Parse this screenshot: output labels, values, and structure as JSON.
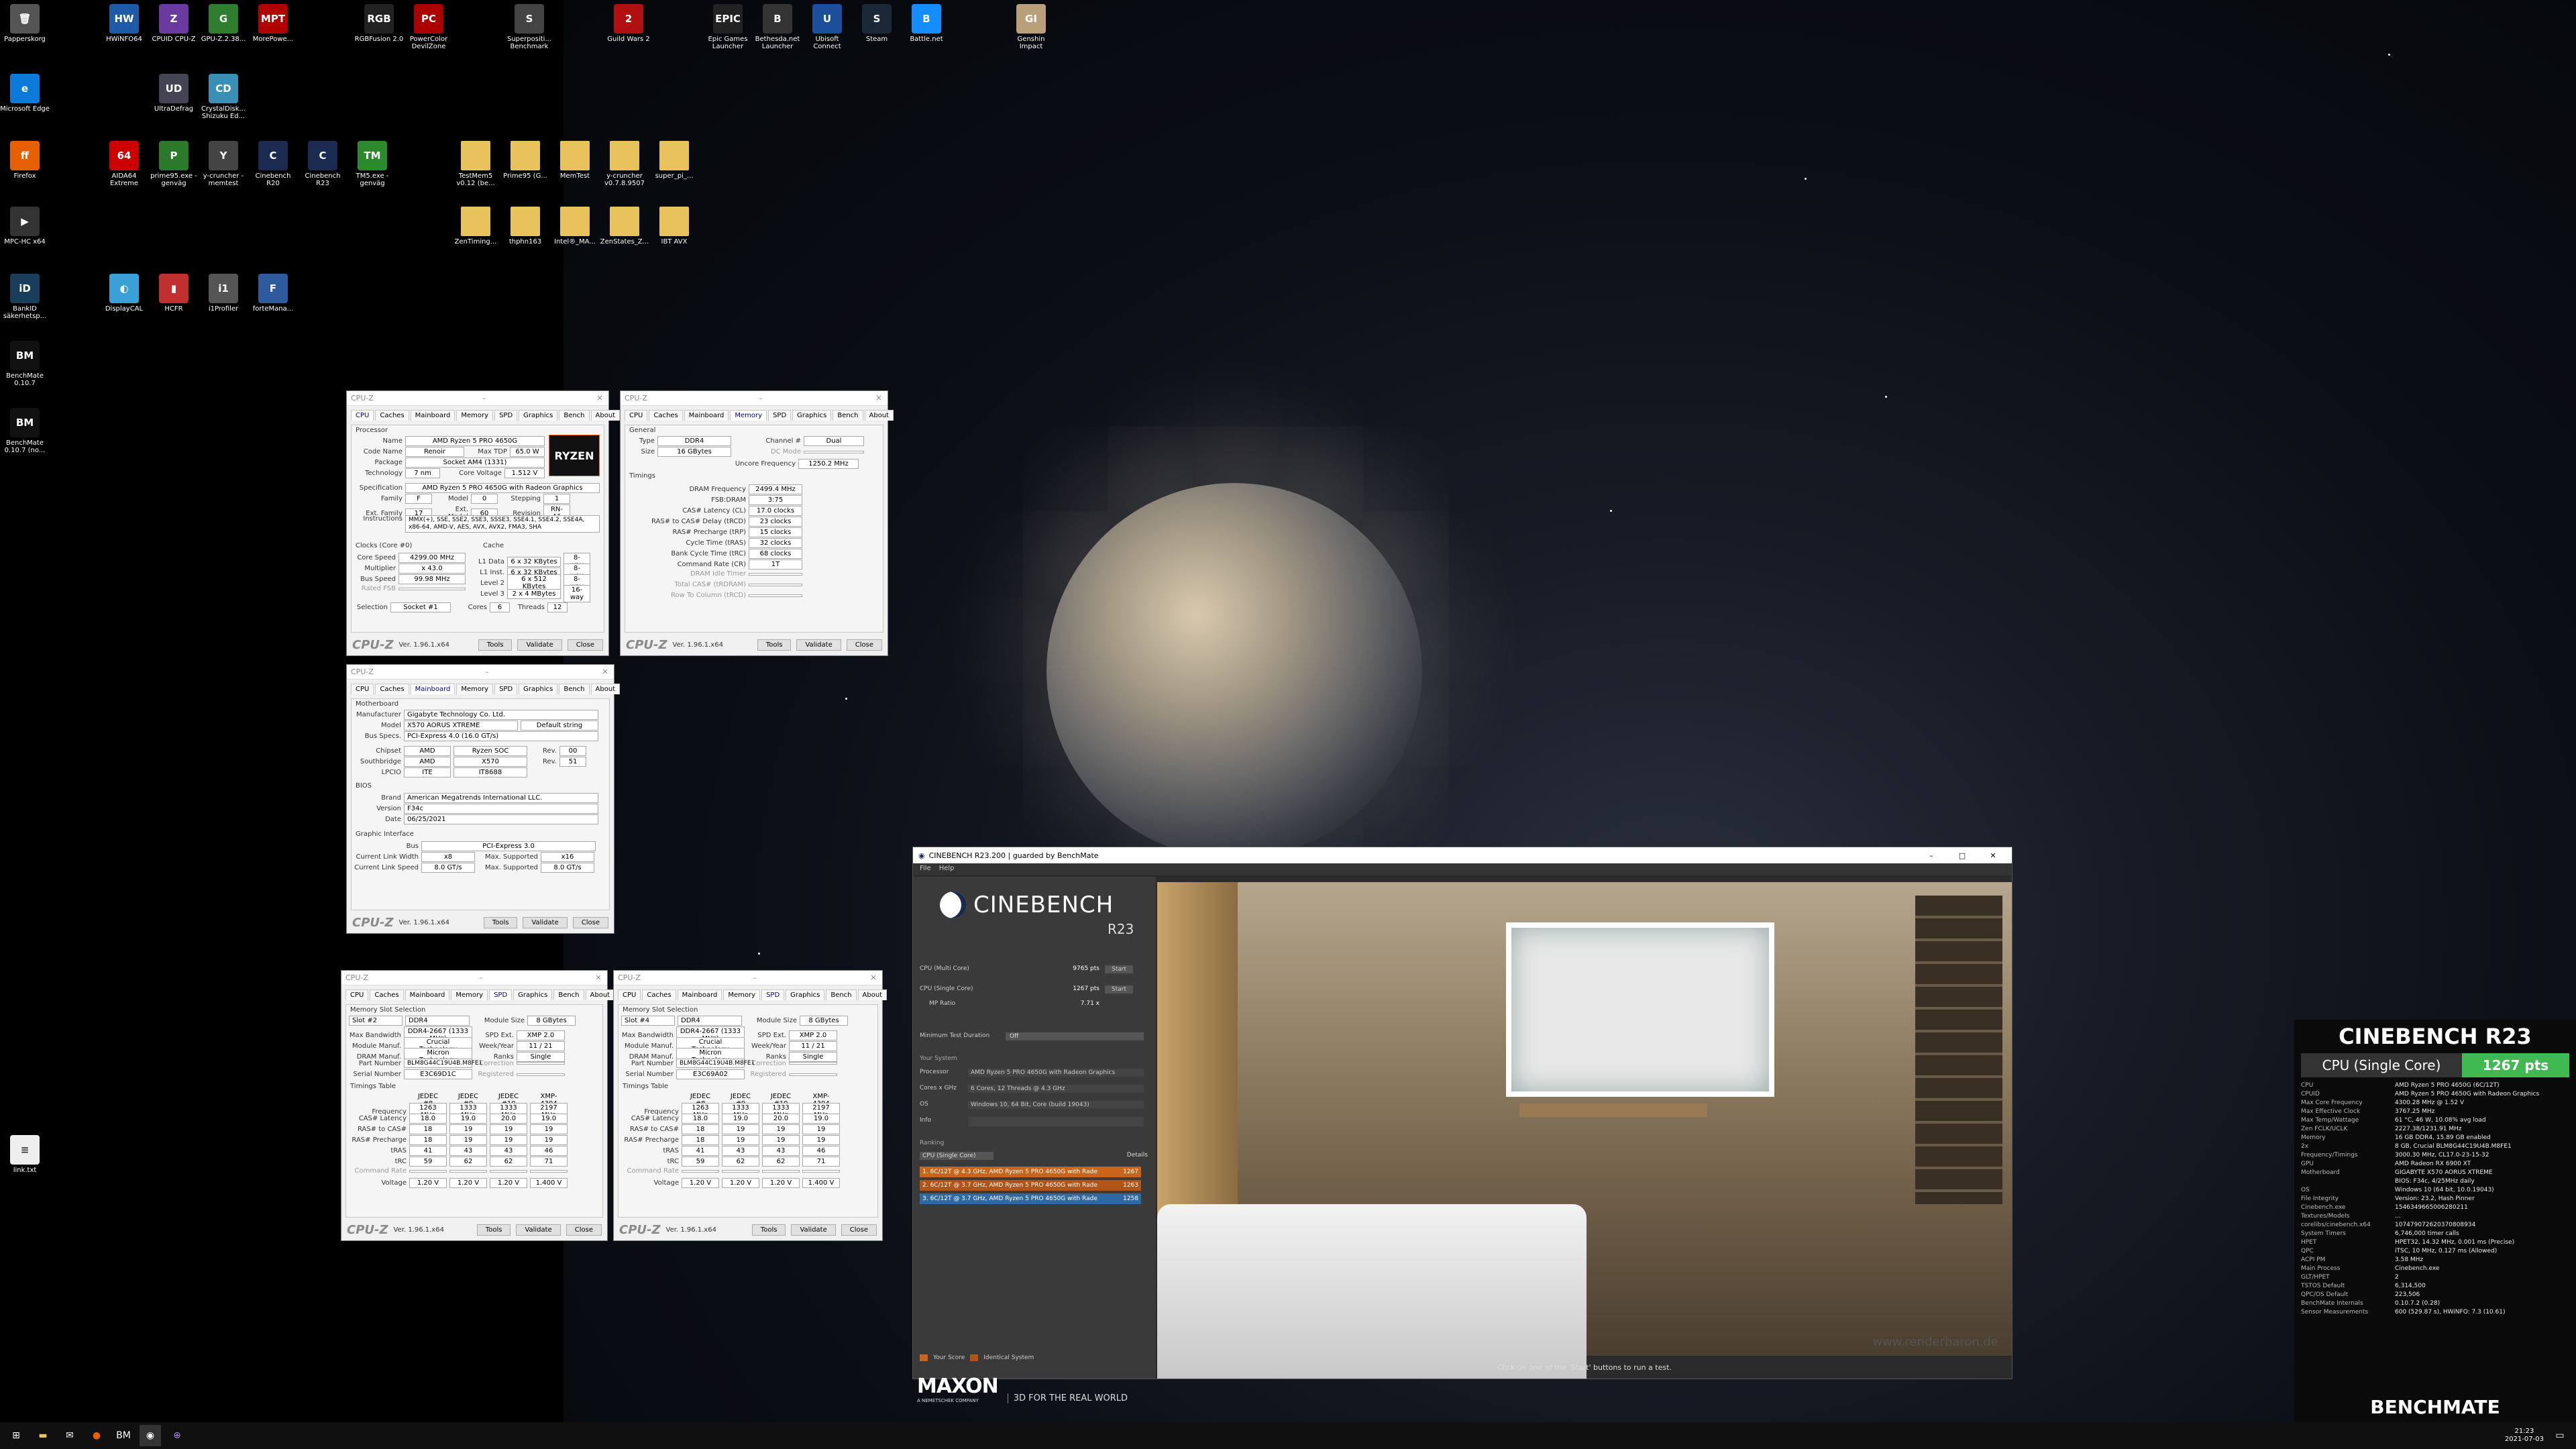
{
  "desktop": {
    "icons": [
      {
        "name": "Papperskorg",
        "glyph": "🗑",
        "color": "#555"
      },
      {
        "name": "HWiNFO64",
        "glyph": "HW",
        "color": "#1d5aa8"
      },
      {
        "name": "CPUID CPU-Z",
        "glyph": "Z",
        "color": "#6b3aa0"
      },
      {
        "name": "GPU-Z.2.38...",
        "glyph": "G",
        "color": "#2f7d2f"
      },
      {
        "name": "MorePowe...",
        "glyph": "MPT",
        "color": "#b00000"
      },
      {
        "name": "RGBFusion 2.0",
        "glyph": "RGB",
        "color": "#222"
      },
      {
        "name": "PowerColor DevilZone",
        "glyph": "PC",
        "color": "#a00"
      },
      {
        "name": "Superpositi... Benchmark",
        "glyph": "S",
        "color": "#444"
      },
      {
        "name": "Guild Wars 2",
        "glyph": "2",
        "color": "#b01010"
      },
      {
        "name": "Epic Games Launcher",
        "glyph": "EPIC",
        "color": "#222"
      },
      {
        "name": "Bethesda.net Launcher",
        "glyph": "B",
        "color": "#333"
      },
      {
        "name": "Ubisoft Connect",
        "glyph": "U",
        "color": "#1b4f9c"
      },
      {
        "name": "Steam",
        "glyph": "S",
        "color": "#1b2838"
      },
      {
        "name": "Battle.net",
        "glyph": "B",
        "color": "#148eff"
      },
      {
        "name": "Genshin Impact",
        "glyph": "GI",
        "color": "#b9a07a"
      },
      {
        "name": "Microsoft Edge",
        "glyph": "e",
        "color": "#0c7ad8"
      },
      {
        "name": "UltraDefrag",
        "glyph": "UD",
        "color": "#445"
      },
      {
        "name": "CrystalDisk... Shizuku Ed...",
        "glyph": "CD",
        "color": "#3a8fb7"
      },
      {
        "name": "Firefox",
        "glyph": "ff",
        "color": "#e66000"
      },
      {
        "name": "AIDA64 Extreme",
        "glyph": "64",
        "color": "#c00"
      },
      {
        "name": "prime95.exe - genväg",
        "glyph": "P",
        "color": "#2a7a2a"
      },
      {
        "name": "y-cruncher - memtest",
        "glyph": "Y",
        "color": "#444"
      },
      {
        "name": "Cinebench R20",
        "glyph": "C",
        "color": "#1b2a50"
      },
      {
        "name": "Cinebench R23",
        "glyph": "C",
        "color": "#1b2a50"
      },
      {
        "name": "TM5.exe - genväg",
        "glyph": "TM",
        "color": "#2b8a2b"
      },
      {
        "name": "TestMem5 v0.12 (be...",
        "glyph": "",
        "color": "#e8c25a"
      },
      {
        "name": "Prime95 (G...",
        "glyph": "",
        "color": "#e8c25a"
      },
      {
        "name": "MemTest",
        "glyph": "",
        "color": "#e8c25a"
      },
      {
        "name": "y-cruncher v0.7.8.9507",
        "glyph": "",
        "color": "#e8c25a"
      },
      {
        "name": "super_pi_...",
        "glyph": "",
        "color": "#e8c25a"
      },
      {
        "name": "MPC-HC x64",
        "glyph": "▶",
        "color": "#333"
      },
      {
        "name": "ZenTiming...",
        "glyph": "",
        "color": "#e8c25a"
      },
      {
        "name": "thphn163",
        "glyph": "",
        "color": "#e8c25a"
      },
      {
        "name": "Intel®_MA...",
        "glyph": "",
        "color": "#e8c25a"
      },
      {
        "name": "ZenStates_Z...",
        "glyph": "",
        "color": "#e8c25a"
      },
      {
        "name": "IBT AVX",
        "glyph": "",
        "color": "#e8c25a"
      },
      {
        "name": "BankID säkerhetsp...",
        "glyph": "iD",
        "color": "#193e5c"
      },
      {
        "name": "DisplayCAL",
        "glyph": "◐",
        "color": "#3aa0d8"
      },
      {
        "name": "HCFR",
        "glyph": "▮",
        "color": "#c03030"
      },
      {
        "name": "i1Profiler",
        "glyph": "i1",
        "color": "#555"
      },
      {
        "name": "forteMana...",
        "glyph": "F",
        "color": "#2e5a9e"
      },
      {
        "name": "BenchMate 0.10.7",
        "glyph": "BM",
        "color": "#111"
      },
      {
        "name": "BenchMate 0.10.7 (no...",
        "glyph": "BM",
        "color": "#111"
      },
      {
        "name": "link.txt",
        "glyph": "≡",
        "color": "#eee"
      }
    ]
  },
  "cpuz1": {
    "title": "CPU-Z",
    "tabs": [
      "CPU",
      "Caches",
      "Mainboard",
      "Memory",
      "SPD",
      "Graphics",
      "Bench",
      "About"
    ],
    "processor_label": "Processor",
    "name": "AMD Ryzen 5 PRO 4650G",
    "code_name": "Renoir",
    "max_tdp": "65.0 W",
    "package": "Socket AM4 (1331)",
    "technology": "7 nm",
    "core_voltage": "1.512 V",
    "spec": "AMD Ryzen 5 PRO 4650G with Radeon Graphics",
    "family": "F",
    "model": "0",
    "stepping": "1",
    "ext_family": "17",
    "ext_model": "60",
    "revision": "RN-A1",
    "instructions": "MMX(+), SSE, SSE2, SSE3, SSSE3, SSE4.1, SSE4.2, SSE4A, x86-64, AMD-V, AES, AVX, AVX2, FMA3, SHA",
    "clocks_label": "Clocks (Core #0)",
    "core_speed": "4299.00 MHz",
    "multiplier": "x 43.0",
    "bus_speed": "99.98 MHz",
    "rated_fsb": "",
    "cache_label": "Cache",
    "l1d": "6 x 32 KBytes",
    "l1d_w": "8-way",
    "l1i": "6 x 32 KBytes",
    "l1i_w": "8-way",
    "l2": "6 x 512 KBytes",
    "l2_w": "8-way",
    "l3": "2 x 4 MBytes",
    "l3_w": "16-way",
    "selection": "Socket #1",
    "cores": "6",
    "threads": "12",
    "k": {
      "name": "Name",
      "code": "Code Name",
      "tdp": "Max TDP",
      "pkg": "Package",
      "tech": "Technology",
      "cv": "Core Voltage",
      "spec": "Specification",
      "fam": "Family",
      "model": "Model",
      "step": "Stepping",
      "efam": "Ext. Family",
      "emod": "Ext. Model",
      "rev": "Revision",
      "inst": "Instructions",
      "cs": "Core Speed",
      "mul": "Multiplier",
      "bus": "Bus Speed",
      "fsb": "Rated FSB",
      "l1d": "L1 Data",
      "l1i": "L1 Inst.",
      "l2": "Level 2",
      "l3": "Level 3",
      "sel": "Selection",
      "cores": "Cores",
      "threads": "Threads"
    },
    "footer": {
      "ver": "Ver. 1.96.1.x64",
      "tools": "Tools",
      "validate": "Validate",
      "close": "Close"
    }
  },
  "cpuz2": {
    "title": "CPU-Z",
    "general": "General",
    "type": "DDR4",
    "channel": "Dual",
    "size": "16 GBytes",
    "dc_mode": "DC Mode",
    "uncore": "1250.2 MHz",
    "timings": "Timings",
    "dram_freq": "2499.4 MHz",
    "fsb_dram": "3:75",
    "cl": "17.0 clocks",
    "trcd": "23 clocks",
    "trp": "15 clocks",
    "tras": "32 clocks",
    "trc": "68 clocks",
    "cr": "1T",
    "k": {
      "type": "Type",
      "size": "Size",
      "chan": "Channel #",
      "unc": "Uncore Frequency",
      "df": "DRAM Frequency",
      "fd": "FSB:DRAM",
      "cl": "CAS# Latency (CL)",
      "rcd": "RAS# to CAS# Delay (tRCD)",
      "rp": "RAS# Precharge (tRP)",
      "ras": "Cycle Time (tRAS)",
      "rc": "Bank Cycle Time (tRC)",
      "cr": "Command Rate (CR)",
      "idle": "DRAM Idle Timer",
      "trdram": "Total CAS# (tRDRAM)",
      "rtc": "Row To Column (tRCD)"
    }
  },
  "cpuz3": {
    "title": "CPU-Z",
    "mb_label": "Motherboard",
    "manufacturer": "Gigabyte Technology Co. Ltd.",
    "model": "X570 AORUS XTREME",
    "model2": "Default string",
    "bus_specs": "PCI-Express 4.0 (16.0 GT/s)",
    "chipset": "AMD",
    "chipset2": "Ryzen SOC",
    "chipset_rev": "00",
    "southbridge": "AMD",
    "southbridge2": "X570",
    "sb_rev": "51",
    "lpcio": "ITE",
    "lpcio2": "IT8688",
    "bios_label": "BIOS",
    "brand": "American Megatrends International LLC.",
    "version": "F34c",
    "date": "06/25/2021",
    "gi_label": "Graphic Interface",
    "gi_bus": "PCI-Express 3.0",
    "link_width": "x8",
    "max_sup": "x16",
    "link_speed": "8.0 GT/s",
    "max_sup2": "8.0 GT/s",
    "k": {
      "man": "Manufacturer",
      "model": "Model",
      "bus": "Bus Specs.",
      "chip": "Chipset",
      "sb": "Southbridge",
      "lpc": "LPCIO",
      "rev": "Rev.",
      "brand": "Brand",
      "ver": "Version",
      "date": "Date",
      "gbus": "Bus",
      "clw": "Current Link Width",
      "cls": "Current Link Speed",
      "ms": "Max. Supported"
    }
  },
  "spd1": {
    "title": "CPU-Z",
    "slot_label": "Memory Slot Selection",
    "slot": "Slot #2",
    "type": "DDR4",
    "module_size": "8 GBytes",
    "max_bw": "DDR4-2667 (1333 MHz)",
    "spd_ext": "XMP 2.0",
    "module_manuf": "Crucial Technology",
    "week_year": "11 / 21",
    "dram_manuf": "Micron Technology",
    "ranks": "Single",
    "part_number": "BLM8G44C19U4B.M8FE1",
    "serial": "E3C69D1C",
    "timings_table": "Timings Table",
    "cols": [
      "JEDEC #8",
      "JEDEC #9",
      "JEDEC #10",
      "XMP-4394"
    ],
    "freq": [
      "1263 MHz",
      "1333 MHz",
      "1333 MHz",
      "2197 MHz"
    ],
    "cas": [
      "18.0",
      "19.0",
      "20.0",
      "19.0"
    ],
    "rcd": [
      "18",
      "19",
      "19",
      "19"
    ],
    "rp": [
      "18",
      "19",
      "19",
      "19"
    ],
    "tras": [
      "41",
      "43",
      "43",
      "46"
    ],
    "trc": [
      "59",
      "62",
      "62",
      "71"
    ],
    "cr": [
      "",
      "",
      "",
      ""
    ],
    "volt": [
      "1.20 V",
      "1.20 V",
      "1.20 V",
      "1.400 V"
    ],
    "k": {
      "ms": "Module Size",
      "mb": "Max Bandwidth",
      "se": "SPD Ext.",
      "mm": "Module Manuf.",
      "wy": "Week/Year",
      "dm": "DRAM Manuf.",
      "rk": "Ranks",
      "pn": "Part Number",
      "cor": "Correction",
      "sn": "Serial Number",
      "reg": "Registered",
      "fr": "Frequency",
      "cas": "CAS# Latency",
      "rcd": "RAS# to CAS#",
      "rp": "RAS# Precharge",
      "tras": "tRAS",
      "trc": "tRC",
      "cr": "Command Rate",
      "v": "Voltage"
    }
  },
  "spd2": {
    "title": "CPU-Z",
    "slot": "Slot #4",
    "type": "DDR4",
    "module_size": "8 GBytes",
    "max_bw": "DDR4-2667 (1333 MHz)",
    "spd_ext": "XMP 2.0",
    "module_manuf": "Crucial Technology",
    "week_year": "11 / 21",
    "dram_manuf": "Micron Technology",
    "ranks": "Single",
    "part_number": "BLM8G44C19U4B.M8FE1",
    "serial": "E3C69A02"
  },
  "cinebench": {
    "title": "CINEBENCH R23.200 | guarded by BenchMate",
    "menu_file": "File",
    "menu_help": "Help",
    "logo": "CINEBENCH",
    "logo_sub": "R23",
    "multi_label": "CPU (Multi Core)",
    "multi_val": "9765 pts",
    "single_label": "CPU (Single Core)",
    "single_val": "1267 pts",
    "mp_label": "MP Ratio",
    "mp_val": "7.71 x",
    "start": "Start",
    "min_dur_label": "Minimum Test Duration",
    "min_dur": "Off",
    "your_system": "Your System",
    "processor_k": "Processor",
    "processor_v": "AMD Ryzen 5 PRO 4650G with Radeon Graphics",
    "cores_k": "Cores x GHz",
    "cores_v": "6 Cores, 12 Threads @ 4.3 GHz",
    "os_k": "OS",
    "os_v": "Windows 10, 64 Bit, Core (build 19043)",
    "info_k": "Info",
    "ranking": "Ranking",
    "rank_sel": "CPU (Single Core)",
    "details": "Details",
    "ranks": [
      {
        "text": "1. 6C/12T @ 4.3 GHz, AMD Ryzen 5 PRO 4650G with Rade",
        "pts": "1267",
        "color": "#c8651b"
      },
      {
        "text": "2. 6C/12T @ 3.7 GHz, AMD Ryzen 5 PRO 4650G with Rade",
        "pts": "1263",
        "color": "#b15416"
      },
      {
        "text": "3. 6C/12T @ 3.7 GHz, AMD Ryzen 5 PRO 4650G with Rade",
        "pts": "1258",
        "color": "#2d6aa3"
      }
    ],
    "your_score": "Your Score",
    "identical": "Identical System",
    "maxon": "MAXON",
    "maxon_sub": "A NEMETSCHEK COMPANY",
    "tagline": "3D FOR THE REAL WORLD",
    "status": "Click on one of the 'Start' buttons to run a test.",
    "watermark": "www.renderbaron.de"
  },
  "benchmate": {
    "title": "CINEBENCH R23",
    "label": "CPU (Single Core)",
    "score": "1267 pts",
    "score_color": "#3fb950",
    "rows": [
      [
        "CPU",
        "AMD Ryzen 5 PRO 4650G (6C/12T)"
      ],
      [
        "CPUID",
        "AMD Ryzen 5 PRO 4650G with Radeon Graphics"
      ],
      [
        "Max Core Frequency",
        "4300.28 MHz @ 1.52 V"
      ],
      [
        "Max Effective Clock",
        "3767.25 MHz"
      ],
      [
        "Max Temp/Wattage",
        "61 °C, 46 W, 10.08% avg load"
      ],
      [
        "Zen FCLK/UCLK",
        "2227.38/1231.91 MHz"
      ],
      [
        "Memory",
        "16 GB DDR4, 15.89 GB enabled"
      ],
      [
        "2x",
        "8 GB, Crucial BLM8G44C19U4B.M8FE1"
      ],
      [
        "Frequency/Timings",
        "3000.30 MHz, CL17.0-23-15-32"
      ],
      [
        "GPU",
        "AMD Radeon RX 6900 XT"
      ],
      [
        "Motherboard",
        "GIGABYTE X570 AORUS XTREME"
      ],
      [
        "",
        "BIOS: F34c, 4/25MHz daily"
      ],
      [
        "OS",
        "Windows 10 (64 bit, 10.0.19043)"
      ],
      [
        "File Integrity",
        "Version: 23.2, Hash Pinner"
      ],
      [
        "Cinebench.exe",
        "1546349665006280211"
      ],
      [
        "Textures/Models",
        "..."
      ],
      [
        "corelibs/cinebench.x64",
        "107479072620370808934"
      ],
      [
        "System Timers",
        "6,746,000 timer calls"
      ],
      [
        "HPET",
        "HPET32, 14.32 MHz, 0.001 ms (Precise)"
      ],
      [
        "QPC",
        "iTSC, 10 MHz, 0.127 ms (Allowed)"
      ],
      [
        "ACPI PM",
        "3.58 MHz"
      ],
      [
        "Main Process",
        "Cinebench.exe"
      ],
      [
        "GLT/HPET",
        "2"
      ],
      [
        "TSTOS Default",
        "6,314,500"
      ],
      [
        "QPC/OS Default",
        "223,506"
      ],
      [
        "BenchMate Internals",
        "0.10.7.2 (0.28)"
      ],
      [
        "Sensor Measurements",
        "600 (529.87 s), HWiNFO: 7.3 (10.61)"
      ]
    ],
    "footer": "BENCHMATE"
  },
  "taskbar": {
    "time": "21:23",
    "date": "2021-07-03"
  }
}
